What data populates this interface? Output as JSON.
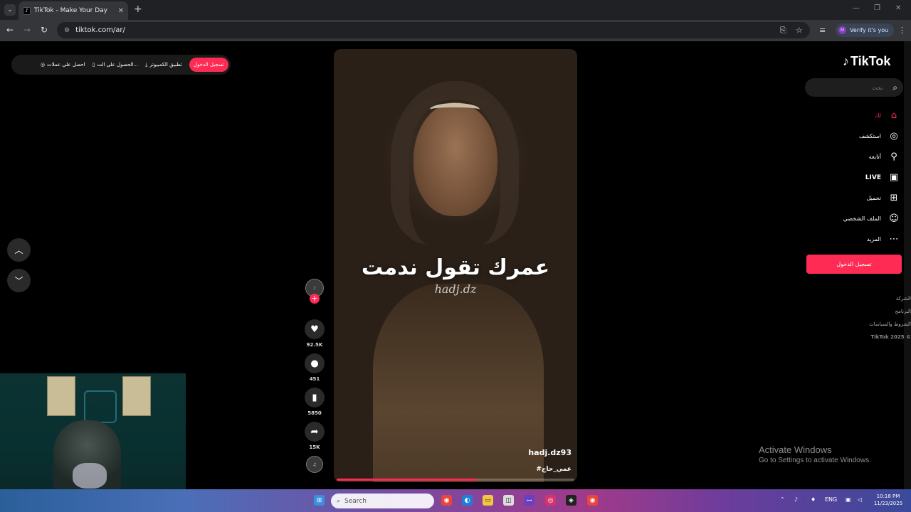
{
  "browser": {
    "tab_title": "TikTok - Make Your Day",
    "url": "tiktok.com/ar/",
    "verify_label": "Verify it's you",
    "profile_initial": "M"
  },
  "topbar": {
    "items": [
      "احصل على عملات",
      "الحصول على الت...",
      "تطبيق الكمبيوتر"
    ],
    "login_label": "تسجيل الدخول"
  },
  "sidebar": {
    "logo": "TikTok",
    "search_placeholder": "بحث",
    "nav": [
      {
        "label": "لك",
        "icon": "home-icon"
      },
      {
        "label": "استكشف",
        "icon": "compass-icon"
      },
      {
        "label": "أتابعه",
        "icon": "following-icon"
      },
      {
        "label": "LIVE",
        "icon": "live-icon"
      },
      {
        "label": "تحميل",
        "icon": "upload-icon"
      },
      {
        "label": "الملف الشخصي",
        "icon": "profile-icon"
      },
      {
        "label": "المزيد",
        "icon": "more-icon"
      }
    ],
    "login_label": "تسجيل الدخول",
    "footer": [
      "الشركة",
      "البرنامج",
      "الشروط والسياسات",
      "TikTok 2025 ©"
    ]
  },
  "video": {
    "caption_arabic": "عمرك تقول ندمت",
    "caption_signature": "hadj.dz",
    "author": "hadj.dz93",
    "hashtag": "#عمي_حاج",
    "progress": 0.59
  },
  "actions": {
    "likes": "92.5K",
    "comments": "451",
    "saves": "5850",
    "shares": "15K"
  },
  "taskbar": {
    "search_placeholder": "Search",
    "lang": "ENG",
    "time": "10:18 PM",
    "date": "11/23/2025"
  },
  "watermark": {
    "line1": "Activate Windows",
    "line2": "Go to Settings to activate Windows."
  },
  "colors": {
    "accent": "#fe2c55",
    "background": "#000000"
  }
}
